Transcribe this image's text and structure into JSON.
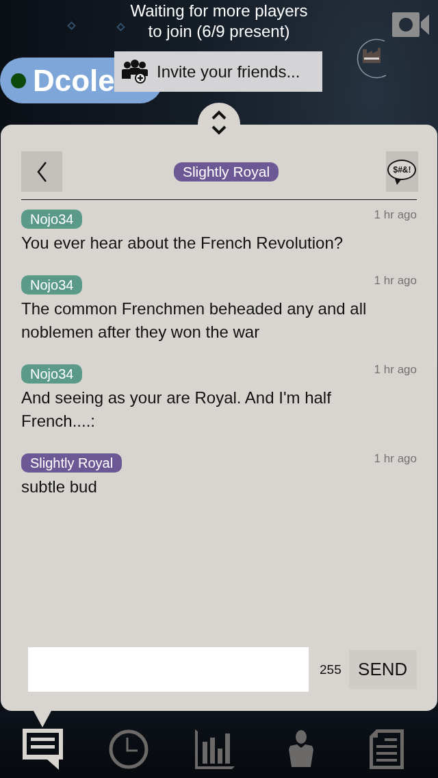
{
  "status": {
    "lines": [
      "Waiting for more players",
      "to join (6/9 present)"
    ]
  },
  "player": {
    "name": "Dcole",
    "online": true
  },
  "invite_button": {
    "label": "Invite your friends..."
  },
  "chat": {
    "title": "Slightly Royal",
    "filter_button": {
      "label": "$#&!"
    },
    "messages": [
      {
        "author": "Nojo34",
        "color": "#5b9a89",
        "time": "1 hr ago",
        "text": "You ever hear about the French Revolution?"
      },
      {
        "author": "Nojo34",
        "color": "#5b9a89",
        "time": "1 hr ago",
        "text": "The common Frenchmen beheaded any and all noblemen after they won the war"
      },
      {
        "author": "Nojo34",
        "color": "#5b9a89",
        "time": "1 hr ago",
        "text": "And seeing as your are Royal. And I'm half French....:"
      },
      {
        "author": "Slightly Royal",
        "color": "#6c5894",
        "time": "1 hr ago",
        "text": "subtle bud"
      }
    ],
    "char_count": "255",
    "send_label": "SEND"
  },
  "nav_tabs": [
    {
      "selected": true
    },
    {
      "selected": false
    },
    {
      "selected": false
    },
    {
      "selected": false
    },
    {
      "selected": false
    }
  ]
}
